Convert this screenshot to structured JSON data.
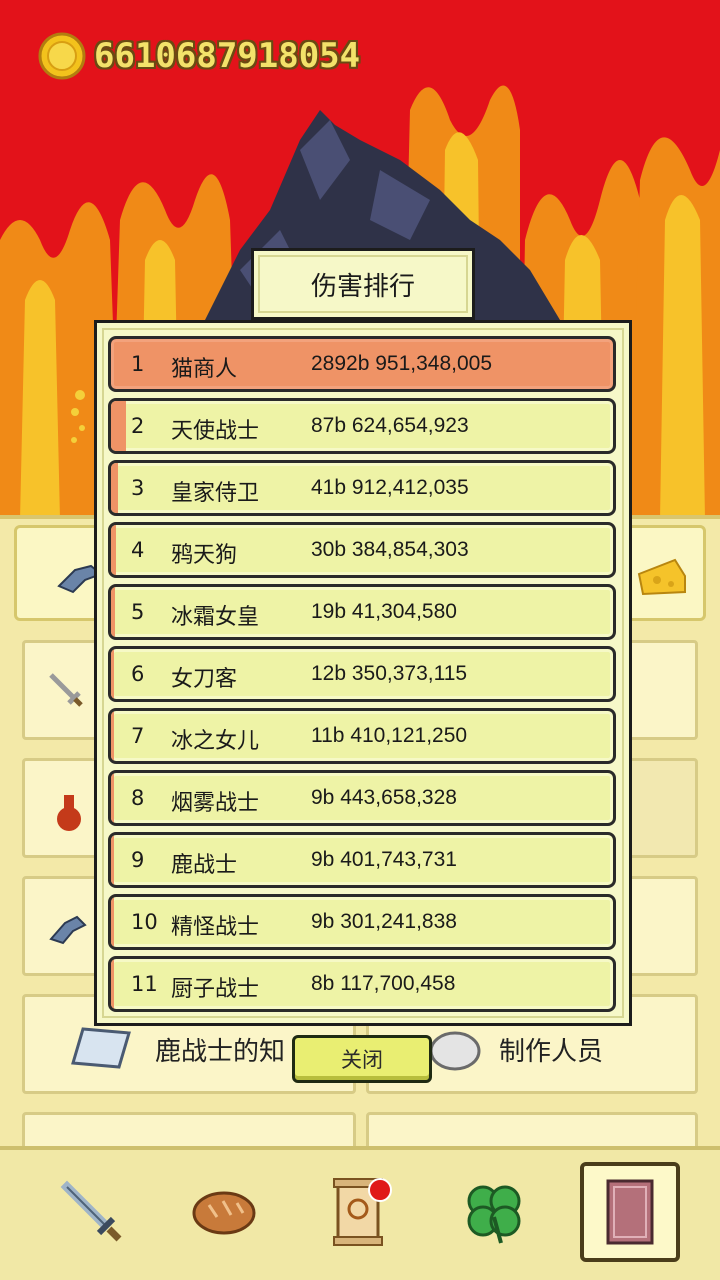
{
  "currency": {
    "amount": "6610687918054",
    "icon": "gold-coin-icon"
  },
  "dialog": {
    "title": "伤害排行",
    "close_label": "关闭",
    "rankings": [
      {
        "rank": "1",
        "name": "猫商人",
        "damage": "2892b 951,348,005",
        "share": 1.0
      },
      {
        "rank": "2",
        "name": "天使战士",
        "damage": "87b 624,654,923",
        "share": 0.03
      },
      {
        "rank": "3",
        "name": "皇家侍卫",
        "damage": "41b 912,412,035",
        "share": 0.014
      },
      {
        "rank": "4",
        "name": "鸦天狗",
        "damage": "30b 384,854,303",
        "share": 0.01
      },
      {
        "rank": "5",
        "name": "冰霜女皇",
        "damage": "19b 41,304,580",
        "share": 0.007
      },
      {
        "rank": "6",
        "name": "女刀客",
        "damage": "12b 350,373,115",
        "share": 0.004
      },
      {
        "rank": "7",
        "name": "冰之女儿",
        "damage": "11b 410,121,250",
        "share": 0.004
      },
      {
        "rank": "8",
        "name": "烟雾战士",
        "damage": "9b 443,658,328",
        "share": 0.003
      },
      {
        "rank": "9",
        "name": "鹿战士",
        "damage": "9b 401,743,731",
        "share": 0.003
      },
      {
        "rank": "10",
        "name": "精怪战士",
        "damage": "9b 301,241,838",
        "share": 0.003
      },
      {
        "rank": "11",
        "name": "厨子战士",
        "damage": "8b 117,700,458",
        "share": 0.003
      }
    ]
  },
  "background_menu": {
    "knowledge_label": "鹿战士的知",
    "credits_label": "制作人员"
  },
  "bottom_nav": [
    {
      "id": "sword",
      "icon": "sword-icon",
      "active": false
    },
    {
      "id": "bread",
      "icon": "bread-icon",
      "active": false
    },
    {
      "id": "scroll",
      "icon": "scroll-icon",
      "active": false,
      "notification": true
    },
    {
      "id": "clover",
      "icon": "clover-icon",
      "active": false
    },
    {
      "id": "book",
      "icon": "book-icon",
      "active": true
    }
  ],
  "colors": {
    "fire_bg": "#e3121a",
    "flame": "#f7a21b",
    "row_bg": "#eef3a6",
    "row_highlight": "#ef9366",
    "coin_text": "#f3e26a"
  }
}
